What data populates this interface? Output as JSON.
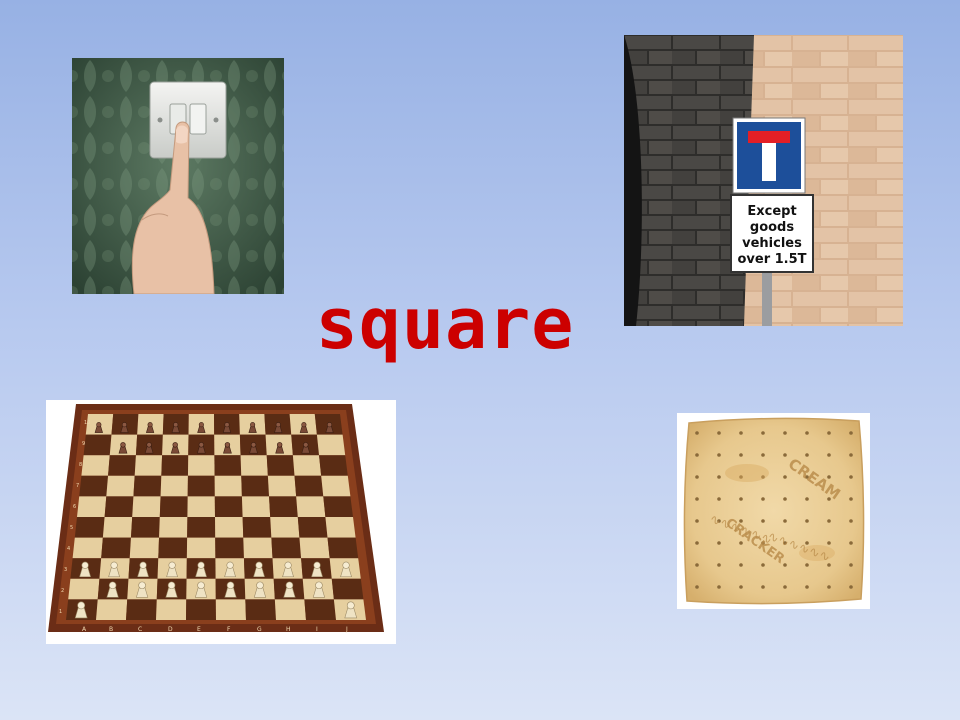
{
  "slide": {
    "title": "square"
  },
  "images": {
    "sign": {
      "lines": [
        "Except",
        "goods",
        "vehicles",
        "over 1.5T"
      ]
    },
    "chess": {
      "file_labels": [
        "A",
        "B",
        "C",
        "D",
        "E",
        "F",
        "G",
        "H",
        "I",
        "J"
      ],
      "rank_labels": [
        "10",
        "9",
        "8",
        "7",
        "6",
        "5",
        "4",
        "3",
        "2",
        "1"
      ]
    },
    "cracker": {
      "words": [
        "CREAM",
        "CRACKER"
      ]
    }
  },
  "colors": {
    "title": "#cc0000",
    "background_top": "#97b1e4",
    "background_bottom": "#dbe4f6"
  }
}
